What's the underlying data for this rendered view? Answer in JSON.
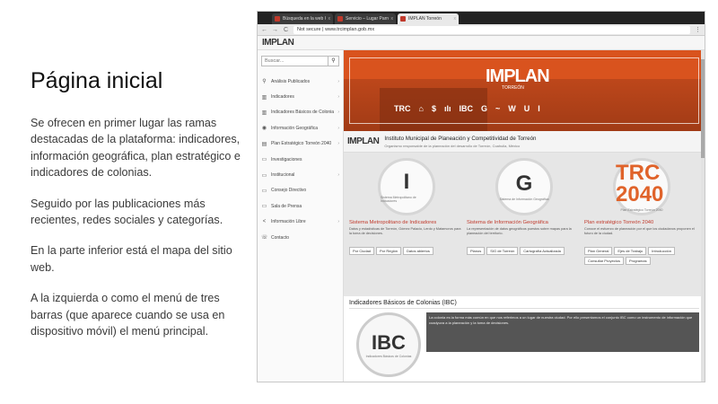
{
  "slide": {
    "title": "Página inicial",
    "paragraphs": [
      "Se ofrecen en primer lugar las ramas destacadas de la plataforma: indicadores, información geográfica, plan estratégico e indicadores de colonias.",
      "Seguido por las publicaciones más recientes, redes sociales y categorías.",
      "En la parte inferior está el mapa del sitio web.",
      "A la izquierda o como el menú de tres barras (que aparece cuando se usa en dispositivo móvil) el menú principal."
    ]
  },
  "browser": {
    "tabs": [
      {
        "title": "Búsqueda en la web Google",
        "close": "x"
      },
      {
        "title": "Servicio – Lugar Parroquial",
        "close": "x"
      },
      {
        "title": "IMPLAN Torreón",
        "close": "x"
      }
    ],
    "url": "Not secure | www.trcimplan.gob.mx",
    "nav": {
      "back": "←",
      "forward": "→",
      "reload": "C",
      "menu": "⋮"
    }
  },
  "site": {
    "logo": "IMPLAN",
    "search_placeholder": "Buscar...",
    "search_icon": "magnifier-icon",
    "sidebar": [
      {
        "icon": "⚲",
        "label": "Análisis Publicados",
        "chevron": "›"
      },
      {
        "icon": "▥",
        "label": "Indicadores",
        "chevron": "›"
      },
      {
        "icon": "▥",
        "label": "Indicadores Básicos de Colonias",
        "chevron": "›"
      },
      {
        "icon": "◉",
        "label": "Información Geográfica",
        "chevron": "›"
      },
      {
        "icon": "▤",
        "label": "Plan Estratégico Torreón 2040",
        "chevron": "›"
      },
      {
        "icon": "▭",
        "label": "Investigaciones",
        "chevron": ""
      },
      {
        "icon": "▭",
        "label": "Institucional",
        "chevron": "›"
      },
      {
        "icon": "▭",
        "label": "Consejo Directivo",
        "chevron": ""
      },
      {
        "icon": "▭",
        "label": "Sala de Prensa",
        "chevron": ""
      },
      {
        "icon": "<",
        "label": "Información Libre",
        "chevron": "›"
      },
      {
        "icon": "☏",
        "label": "Contacto",
        "chevron": ""
      }
    ],
    "hero": {
      "logo": "IMPLAN",
      "subtitle": "TORREÓN",
      "icons": [
        "TRC",
        "⌂",
        "$",
        "ılı",
        "IBC",
        "G",
        "~",
        "W",
        "U",
        "I"
      ]
    },
    "institute": {
      "logo": "IMPLAN",
      "name": "Instituto Municipal de Planeación y Competitividad de Torreón",
      "description": "Organismo responsable de la planeación del desarrollo de Torreón, Coahuila, México"
    },
    "cards": [
      {
        "big": "I",
        "small": "Sistema Metropolitano de Indicadores",
        "title": "Sistema Metropolitano de Indicadores",
        "desc": "Datos y estadísticas de Torreón, Gómez Palacio, Lerdo y Matamoros para la toma de decisiones.",
        "buttons": [
          "Por Ciudad",
          "Por Región",
          "Datos abiertos"
        ]
      },
      {
        "big": "G",
        "small": "Sistema de Información Geográfica",
        "title": "Sistema de Información Geográfica",
        "desc": "La representación de datos geográficos puestos sobre mapas para la planeación del territorio.",
        "buttons": [
          "Planos",
          "SIG de Torreón",
          "Cartografía Actualizada"
        ]
      },
      {
        "big": "TRC 2040",
        "small": "Plan Estratégico Torreón 2040",
        "title": "Plan estratégico Torreón 2040",
        "desc": "Conoce el esfuerzo de planeación por el que los ciudadanos proponen el futuro de la ciudad.",
        "buttons": [
          "Plan General",
          "Ejes de Trabajo",
          "Introducción",
          "Consultar Proyectos",
          "Programas"
        ]
      }
    ],
    "ibc": {
      "title": "Indicadores Básicos de Colonias (IBC)",
      "big": "IBC",
      "small": "Indicadores Básicos de Colonias",
      "desc": "La colonia es la forma más común en que nos referimos a un lugar de nuestra ciudad. Por ello presentamos el conjunto IBC como un instrumento de información que coadyuva a la planeación y la toma de decisiones."
    }
  },
  "colors": {
    "accent": "#d9531e",
    "accent_text": "#c0392b"
  }
}
